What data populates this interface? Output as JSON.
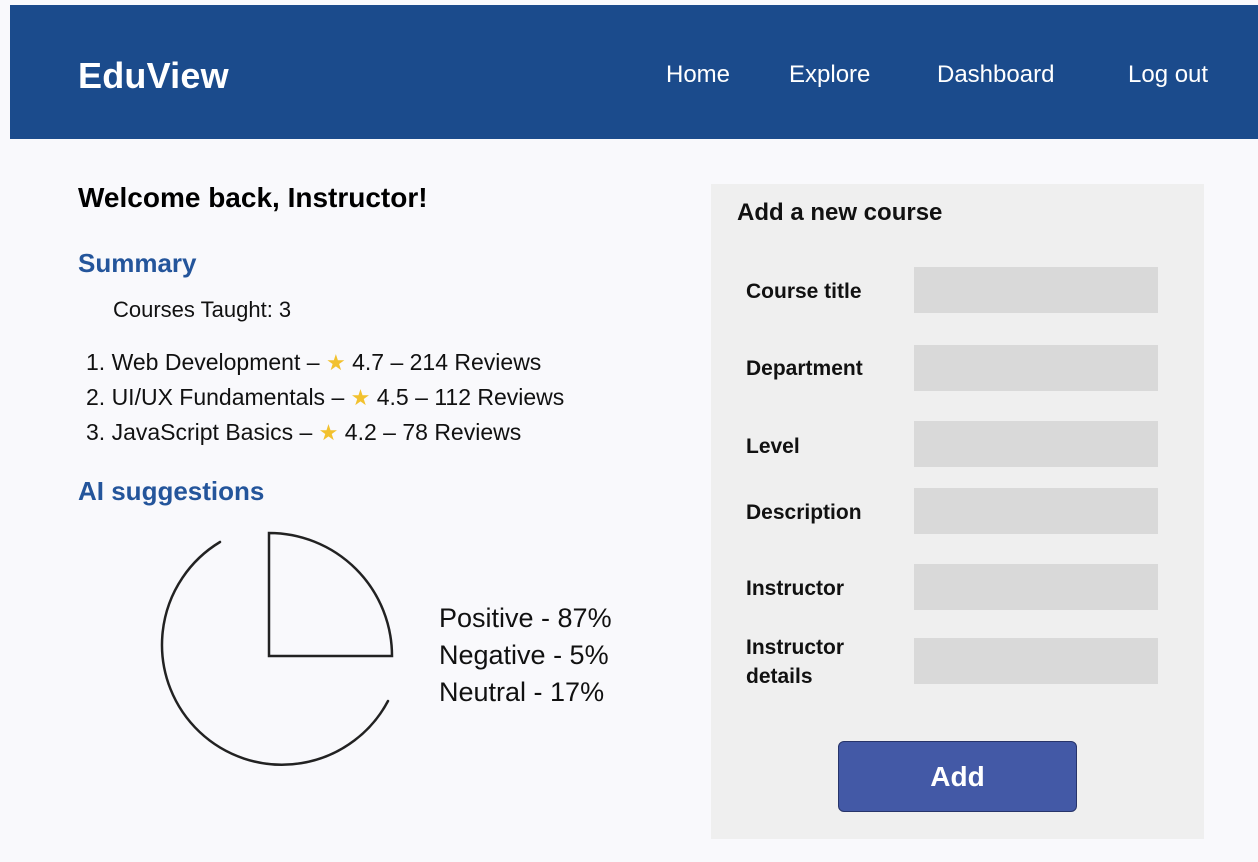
{
  "app": {
    "brand": "EduView"
  },
  "nav": {
    "items": [
      "Home",
      "Explore",
      "Dashboard",
      "Log out"
    ]
  },
  "main": {
    "welcome": "Welcome back, Instructor!",
    "summary_title": "Summary",
    "courses_taught": "Courses Taught: 3",
    "courses": [
      {
        "prefix": "1. Web Development –",
        "rating": "4.7",
        "reviews": "214 Reviews"
      },
      {
        "prefix": "2. UI/UX Fundamentals –",
        "rating": "4.5",
        "reviews": "112 Reviews"
      },
      {
        "prefix": "3. JavaScript Basics –",
        "rating": "4.2",
        "reviews": "78 Reviews"
      }
    ],
    "separator": "–",
    "star_glyph": "★",
    "ai_title": "AI suggestions"
  },
  "chart_data": {
    "type": "pie",
    "categories": [
      "Positive",
      "Negative",
      "Neutral"
    ],
    "values": [
      87,
      5,
      17
    ],
    "legend": [
      "Positive - 87%",
      "Negative - 5%",
      "Neutral - 17%"
    ],
    "style": "outline-sketch"
  },
  "form": {
    "title": "Add a new course",
    "fields": [
      {
        "label": "Course title",
        "value": ""
      },
      {
        "label": "Department",
        "value": ""
      },
      {
        "label": "Level",
        "value": ""
      },
      {
        "label": "Description",
        "value": ""
      },
      {
        "label": "Instructor",
        "value": ""
      },
      {
        "label": "Instructor details",
        "value": ""
      }
    ],
    "submit_label": "Add"
  },
  "colors": {
    "header_bg": "#1b4b8c",
    "section_title": "#24559b",
    "panel_bg": "#efefef",
    "input_bg": "#d9d9d9",
    "button_bg": "#4359a6",
    "star": "#f2c12e"
  },
  "icons": {
    "star": "star-icon"
  }
}
